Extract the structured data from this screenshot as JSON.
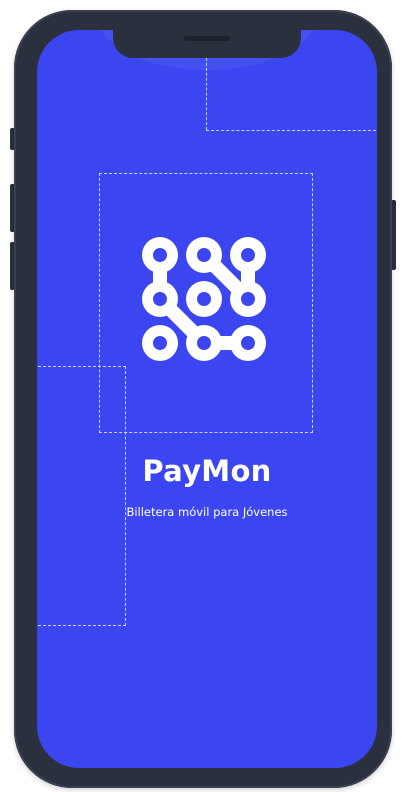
{
  "app": {
    "brand_name": "PayMon",
    "tagline": "Billetera móvil para Jóvenes",
    "logo_icon": "pattern-lock-icon"
  },
  "colors": {
    "screen_background": "#3b46f1",
    "device_frame": "#2b303e",
    "foreground": "#ffffff"
  }
}
